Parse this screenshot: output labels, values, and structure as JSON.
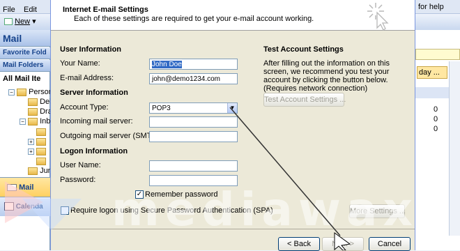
{
  "outlook": {
    "menu": [
      "File",
      "Edit"
    ],
    "help_text": "for help",
    "new_label": "New",
    "pane_title": "Mail",
    "favorite_label": "Favorite Fold",
    "mail_folders_label": "Mail Folders",
    "all_mail_label": "All Mail Ite",
    "tree": [
      "Person",
      "Del",
      "Dra",
      "Inb",
      "Jun"
    ],
    "calendar_btn": "Calenda",
    "mail_btn": "Mail",
    "right_day_text": "day ...",
    "right_counts": [
      "0",
      "0",
      "0"
    ]
  },
  "dialog": {
    "title": "Internet E-mail Settings",
    "subtitle": "Each of these settings are required to get your e-mail account working.",
    "user_info": {
      "heading": "User Information",
      "name_label": "Your Name:",
      "name_value": "John Doe",
      "email_label": "E-mail Address:",
      "email_value": "john@demo1234.com"
    },
    "server_info": {
      "heading": "Server Information",
      "account_type_label": "Account Type:",
      "account_type_value": "POP3",
      "incoming_label": "Incoming mail server:",
      "incoming_value": "",
      "outgoing_label": "Outgoing mail server (SMTP):",
      "outgoing_value": ""
    },
    "logon_info": {
      "heading": "Logon Information",
      "username_label": "User Name:",
      "username_value": "",
      "password_label": "Password:",
      "password_value": "",
      "remember_label": "Remember password",
      "remember_checked": true,
      "spa_label": "Require logon using Secure Password Authentication (SPA)",
      "spa_checked": false
    },
    "test": {
      "heading": "Test Account Settings",
      "description": "After filling out the information on this screen, we recommend you test your account by clicking the button below. (Requires network connection)",
      "button": "Test Account Settings ..."
    },
    "more_settings": "More Settings ...",
    "back": "< Back",
    "next": "Next >",
    "cancel": "Cancel"
  },
  "watermark": "mediawax"
}
